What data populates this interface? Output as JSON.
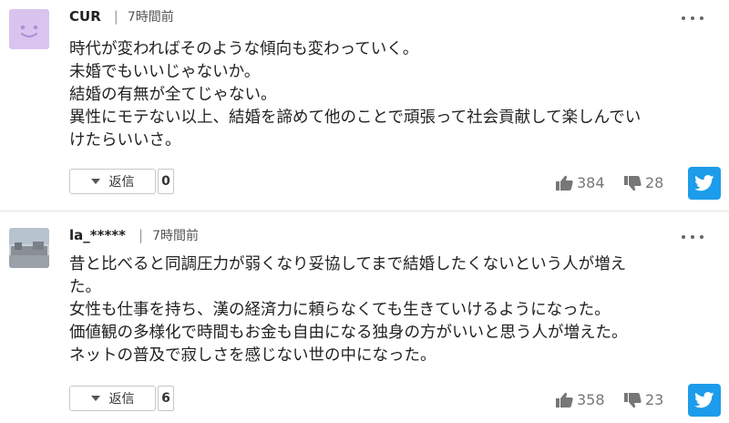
{
  "comments": [
    {
      "user": "CUR",
      "time": "7時間前",
      "body_lines": [
        "時代が変わればそのような傾向も変わっていく。",
        "未婚でもいいじゃないか。",
        "結婚の有無が全てじゃない。",
        "異性にモテない以上、結婚を諦めて他のことで頑張って社会貢献して楽しんでい",
        "けたらいいさ。"
      ],
      "reply_label": "返信",
      "reply_count": "0",
      "likes": "384",
      "dislikes": "28"
    },
    {
      "user": "la_*****",
      "time": "7時間前",
      "body_lines": [
        "昔と比べると同調圧力が弱くなり妥協してまで結婚したくないという人が増え",
        "た。",
        "女性も仕事を持ち、漢の経済力に頼らなくても生きていけるようになった。",
        "価値観の多様化で時間もお金も自由になる独身の方がいいと思う人が増えた。",
        "ネットの普及で寂しさを感じない世の中になった。"
      ],
      "reply_label": "返信",
      "reply_count": "6",
      "likes": "358",
      "dislikes": "23"
    }
  ],
  "separator": "|",
  "colors": {
    "twitter": "#1c9cea",
    "avatar_face": "#d9c4ef"
  },
  "icons": [
    "smiley-avatar-icon",
    "photo-avatar-icon",
    "more-menu-icon",
    "caret-down-icon",
    "thumbs-up-icon",
    "thumbs-down-icon",
    "twitter-icon"
  ]
}
